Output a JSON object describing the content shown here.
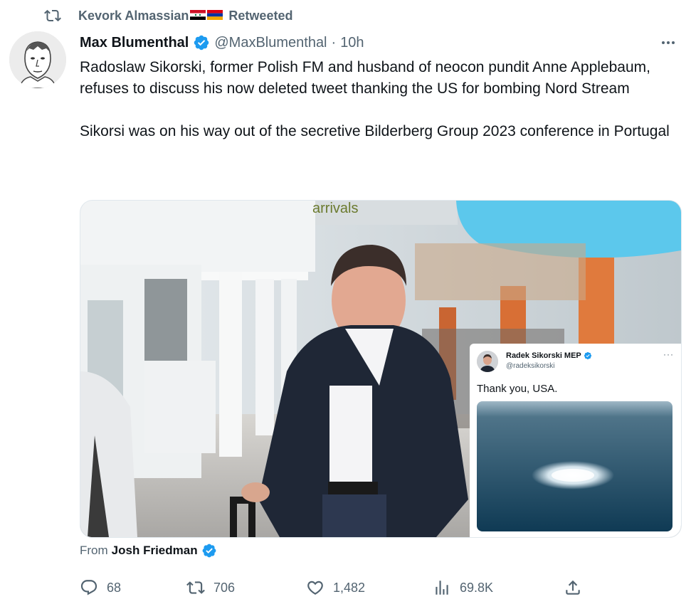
{
  "retweet": {
    "user": "Kevork Almassian",
    "label": "Retweeted",
    "icon": "retweet-icon",
    "flags": [
      "syria-flag",
      "armenia-flag"
    ]
  },
  "tweet": {
    "author_name": "Max Blumenthal",
    "handle": "@MaxBlumenthal",
    "separator": "·",
    "time": "10h",
    "more_icon": "more-icon",
    "paragraphs": [
      "Radoslaw Sikorski, former Polish FM and husband of neocon pundit Anne Applebaum, refuses to discuss his now deleted tweet thanking the US for bombing Nord Stream",
      "Sikorsi was on his way out of the secretive Bilderberg Group 2023 conference in Portugal"
    ]
  },
  "media": {
    "sign_text": "arrivals",
    "inset": {
      "name": "Radek Sikorski MEP",
      "handle": "@radeksikorski",
      "text": "Thank you, USA.",
      "more": "···"
    }
  },
  "source": {
    "label": "From",
    "user": "Josh Friedman"
  },
  "actions": {
    "replies": "68",
    "retweets": "706",
    "likes": "1,482",
    "views": "69.8K"
  },
  "colors": {
    "text": "#0f1419",
    "secondary": "#536471",
    "verified": "#1d9bf0",
    "sky_sign": "#5cc8ec"
  }
}
